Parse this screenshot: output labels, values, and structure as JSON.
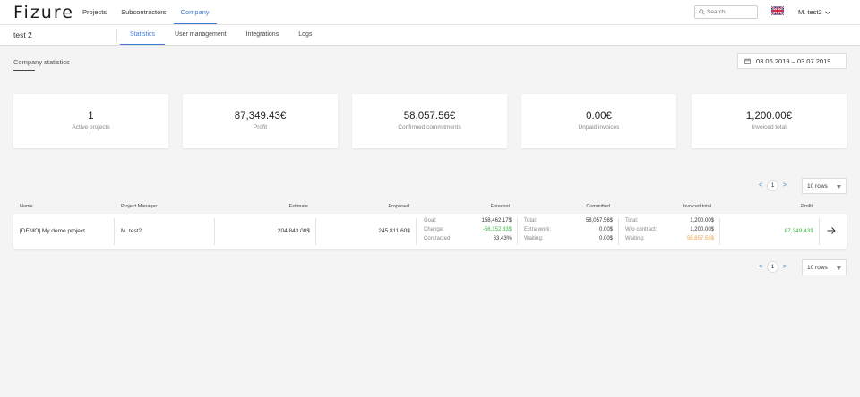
{
  "header": {
    "logo": "Fizure",
    "nav": [
      "Projects",
      "Subcontractors",
      "Company"
    ],
    "search_placeholder": "Search",
    "user": "M. test2",
    "flag": "uk-flag"
  },
  "subheader": {
    "company": "test 2",
    "tabs": [
      "Statistics",
      "User management",
      "Integrations",
      "Logs"
    ]
  },
  "stats": {
    "title": "Company statistics",
    "date_range": "03.06.2019  – 03.07.2019",
    "cards": [
      {
        "value": "1",
        "label": "Active projects"
      },
      {
        "value": "87,349.43€",
        "label": "Profit"
      },
      {
        "value": "58,057.56€",
        "label": "Confirmed commitments"
      },
      {
        "value": "0.00€",
        "label": "Unpaid invoices"
      },
      {
        "value": "1,200.00€",
        "label": "Invoiced total"
      }
    ]
  },
  "pagination": {
    "prev": "<",
    "page": "1",
    "next": ">",
    "rows": "10 rows"
  },
  "table": {
    "columns": [
      "Name",
      "Project Manager",
      "Estimate",
      "Proposed",
      "Forecast",
      "Committed",
      "Invoiced total",
      "Profit"
    ],
    "row": {
      "name": "[DEMO] My demo project",
      "manager": "M. test2",
      "estimate": "204,843.00$",
      "proposed": "245,811.60$",
      "forecast": {
        "goal_label": "Goal:",
        "goal": "158,462.17$",
        "change_label": "Change:",
        "change": "-56,152.83$",
        "contracted_label": "Contracted:",
        "contracted": "63.43%"
      },
      "committed": {
        "total_label": "Total:",
        "total": "58,057.56$",
        "extra_label": "Extra work:",
        "extra": "0.00$",
        "waiting_label": "Waiting:",
        "waiting": "0.00$"
      },
      "invoiced": {
        "total_label": "Total:",
        "total": "1,200.00$",
        "wo_label": "W/o contract:",
        "wo": "1,200.00$",
        "waiting_label": "Waiting:",
        "waiting": "58,857.56$"
      },
      "profit": "87,349.43$"
    }
  },
  "colors": {
    "accent": "#3d7bd6",
    "positive": "#3cb54a",
    "warning": "#f0a050"
  }
}
